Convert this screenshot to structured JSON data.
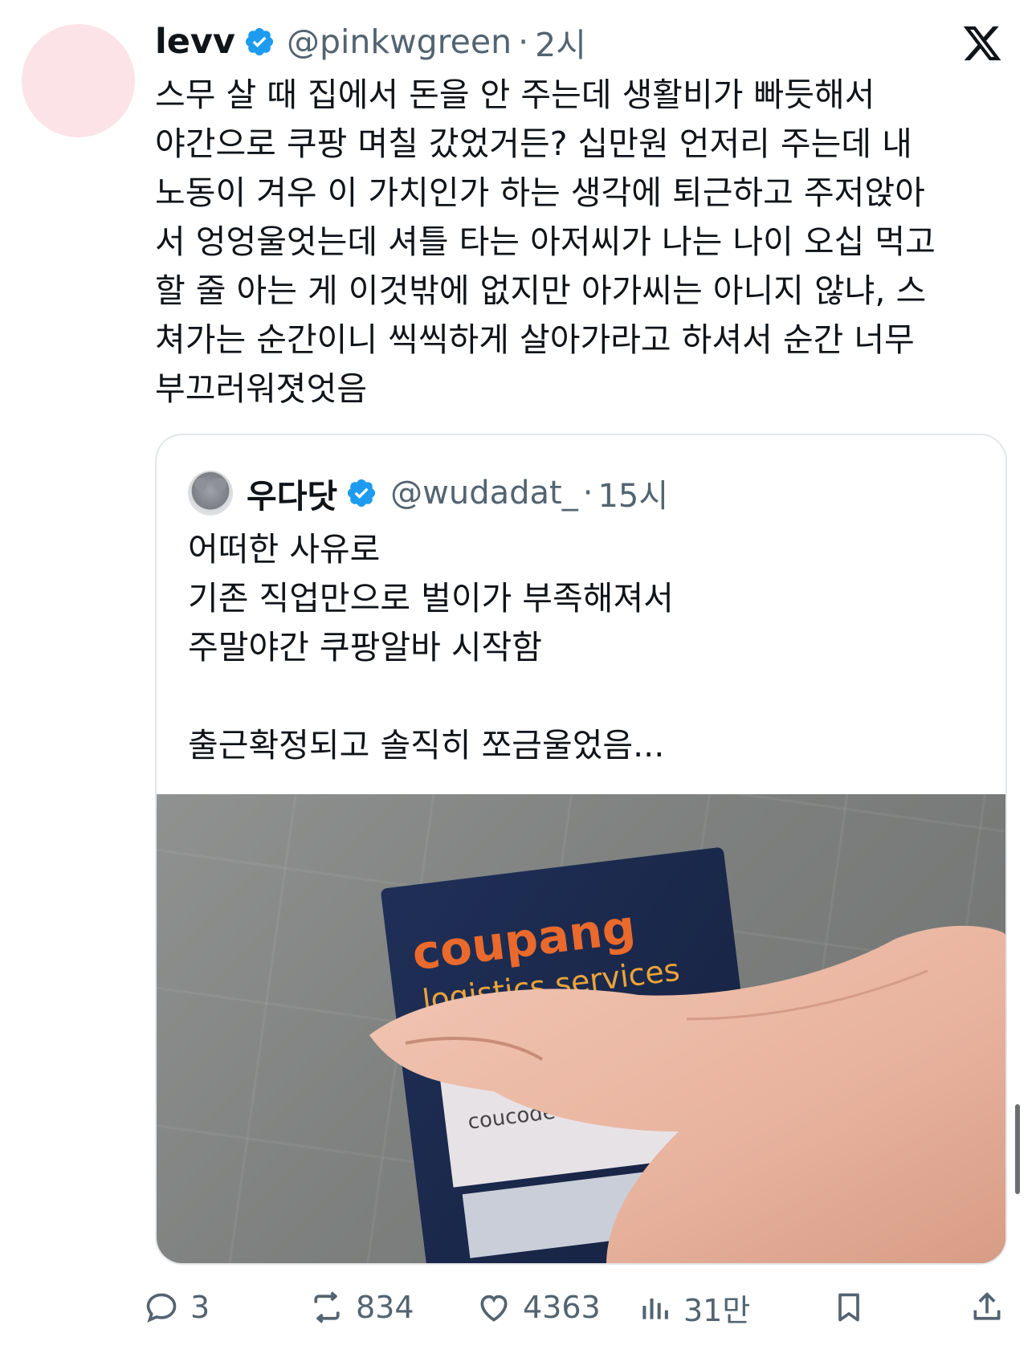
{
  "post": {
    "display_name": "levv",
    "handle": "@pinkwgreen",
    "separator": "·",
    "time": "2시",
    "text_lines": [
      "스무 살 때 집에서 돈을 안 주는데 생활비가 빠듯해서",
      "야간으로 쿠팡 며칠 갔었거든? 십만원 언저리 주는데 내",
      "노동이 겨우 이 가치인가 하는 생각에 퇴근하고 주저앉아",
      "서 엉엉울엇는데 셔틀 타는 아저씨가 나는 나이 오십 먹고",
      "할 줄 아는 게 이것밖에 없지만 아가씨는 아니지 않냐, 스",
      "쳐가는 순간이니 씩씩하게 살아가라고 하셔서 순간 너무",
      "부끄러워졋엇음"
    ]
  },
  "quote": {
    "display_name": "우다닷",
    "handle": "@wudadat_",
    "separator": "·",
    "time": "15시",
    "text_lines": [
      "어떠한 사유로",
      "기존 직업만으로 벌이가 부족해져서",
      "주말야간 쿠팡알바 시작함",
      "",
      "출근확정되고 솔직히 쪼금울었음..."
    ],
    "image": {
      "badge_brand": "coupang",
      "badge_subtitle": "logistics services",
      "badge_field": "coucode :"
    }
  },
  "actions": {
    "replies": "3",
    "reposts": "834",
    "likes": "4363",
    "views": "31만"
  },
  "colors": {
    "verified_blue": "#1d9bf0",
    "secondary_text": "#536471",
    "avatar_pink": "#fbe3e8"
  },
  "icons": [
    "verified-badge-icon",
    "x-logo-icon",
    "reply-icon",
    "repost-icon",
    "like-icon",
    "views-icon",
    "bookmark-icon",
    "share-icon"
  ]
}
